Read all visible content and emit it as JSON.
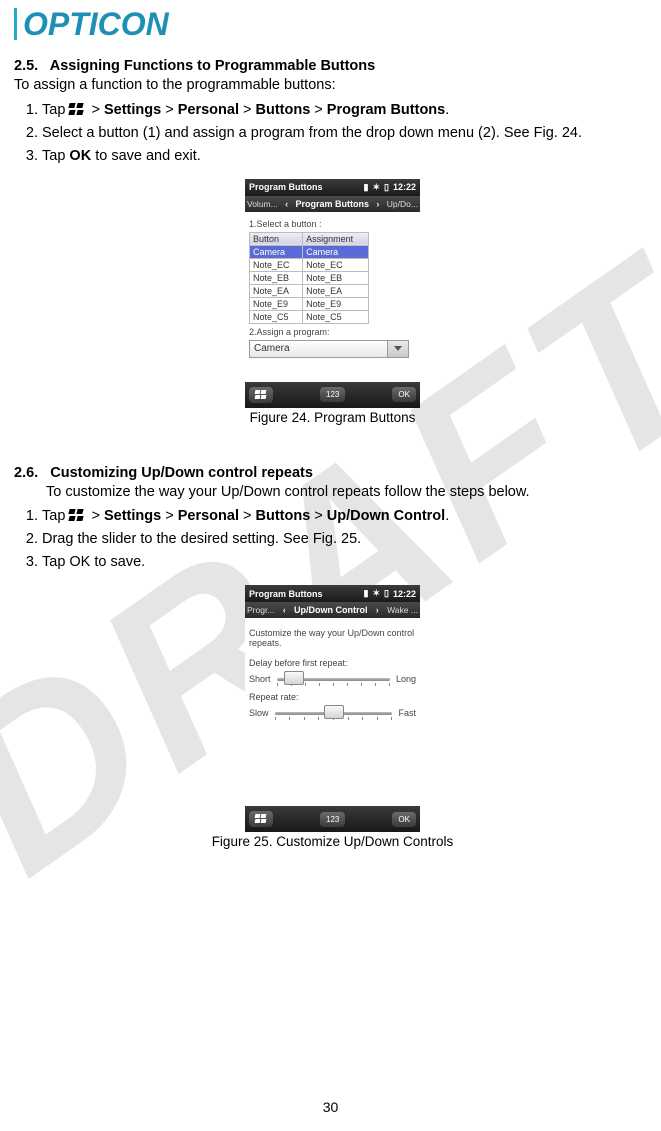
{
  "brand": "OPTICON",
  "watermark": "DRAFT",
  "page_number": "30",
  "section25": {
    "heading_num": "2.5.",
    "heading_text": "Assigning Functions to Programmable Buttons",
    "intro": "To assign a function to the programmable buttons:",
    "steps": [
      {
        "pre": "Tap ",
        "path_bold": [
          "Settings",
          "Personal",
          "Buttons",
          "Program Buttons"
        ],
        "post": "."
      },
      {
        "text": "Select a button (1) and assign a program from the drop down menu (2). See Fig. 24."
      },
      {
        "pre": "Tap ",
        "bold": "OK",
        "post": " to save and exit."
      }
    ],
    "caption": "Figure 24.  Program Buttons"
  },
  "section26": {
    "heading_num": "2.6.",
    "heading_text": "Customizing Up/Down control repeats",
    "intro": "To customize the way your Up/Down control repeats follow the steps below.",
    "steps": [
      {
        "pre": "Tap ",
        "path_bold": [
          "Settings",
          "Personal",
          "Buttons",
          "Up/Down Control"
        ],
        "post": "."
      },
      {
        "text": "Drag the slider to the desired setting. See Fig. 25."
      },
      {
        "text": "Tap OK to save."
      }
    ],
    "caption": "Figure 25. Customize Up/Down Controls"
  },
  "phone24": {
    "status_title": "Program Buttons",
    "clock": "12:22",
    "tab_left": "Volum...",
    "tab_mid": "Program Buttons",
    "tab_right": "Up/Do...",
    "label1": "1.Select a button :",
    "col_button": "Button",
    "col_assign": "Assignment",
    "rows": [
      {
        "b": "Camera",
        "a": "Camera",
        "sel": true
      },
      {
        "b": "Note_EC",
        "a": "Note_EC"
      },
      {
        "b": "Note_EB",
        "a": "Note_EB"
      },
      {
        "b": "Note_EA",
        "a": "Note_EA"
      },
      {
        "b": "Note_E9",
        "a": "Note_E9"
      },
      {
        "b": "Note_C5",
        "a": "Note_C5"
      }
    ],
    "label2": "2.Assign a program:",
    "dropdown_value": "Camera",
    "kb_label": "123",
    "ok_label": "OK"
  },
  "phone25": {
    "status_title": "Program Buttons",
    "clock": "12:22",
    "tab_left": "Progr...",
    "tab_mid": "Up/Down Control",
    "tab_right": "Wake ...",
    "desc": "Customize the way your Up/Down control repeats.",
    "label_delay": "Delay before first repeat:",
    "short": "Short",
    "long": "Long",
    "label_rate": "Repeat rate:",
    "slow": "Slow",
    "fast": "Fast",
    "kb_label": "123",
    "ok_label": "OK"
  }
}
